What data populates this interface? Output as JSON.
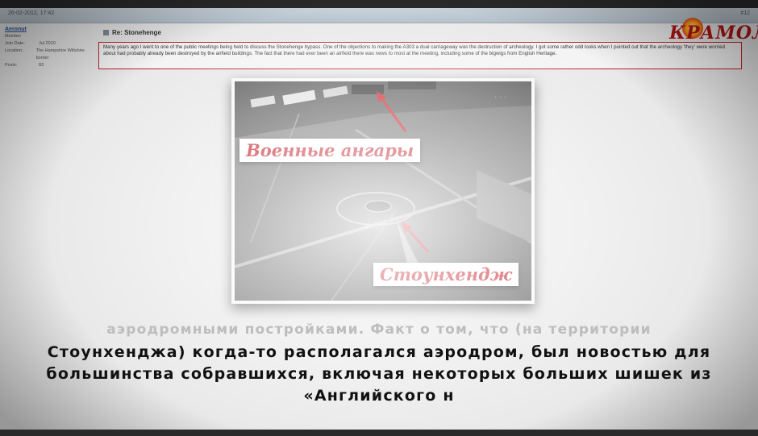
{
  "forum": {
    "date": "26-02-2012, 17:42",
    "post_number": "#12",
    "user": {
      "name": "Aeronut",
      "rank": "Member",
      "join_label": "Join Date:",
      "join_value": "Jul 2010",
      "location_label": "Location:",
      "location_value": "The Hampshire Wiltshire border",
      "posts_label": "Posts:",
      "posts_value": "83"
    },
    "post_title": "Re: Stonehenge",
    "post_text": "Many years ago I went to one of the public meetings being held to discuss the Stonehenge bypass. One of the objections to making the A303 a dual carriageway was the destruction of archeology. I got some rather odd looks when I pointed out that the archeology 'they' were worried about had probably already been destroyed by the airfield buildings. The fact that there had ever been an airfield there was news to most at the meeting, including some of the bigwigs from English Heritage."
  },
  "logo": {
    "text": "КРАМОЛА"
  },
  "photo": {
    "label_hangars": "Военные ангары",
    "label_stonehenge": "Стоунхендж"
  },
  "subtitle": {
    "faded": "аэродромными постройками. Факт о том, что (на территории",
    "line1": "Стоунхенджа) когда-то располагался аэродром, был новостью для",
    "line2": "большинства собравшихся, включая некоторых больших шишек из",
    "line3": "«Английского н"
  },
  "colors": {
    "accent": "#c1121c",
    "highlight_border": "#c0202a"
  }
}
